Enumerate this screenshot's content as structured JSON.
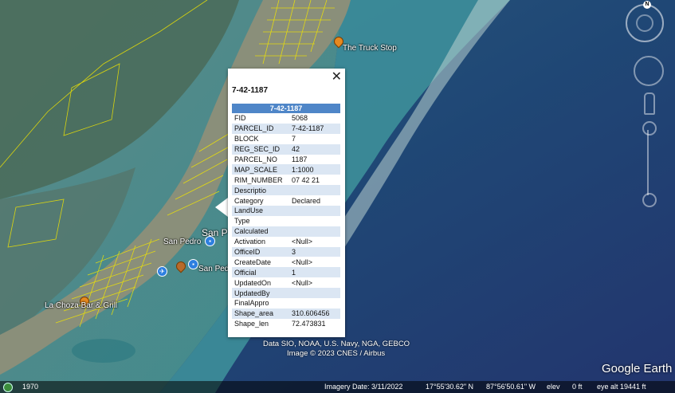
{
  "map": {
    "places": [
      {
        "name": "The Truck Stop"
      },
      {
        "name": "San Pedro"
      },
      {
        "name": "San Pedro Airport"
      },
      {
        "name": "La Choza Bar & Grill"
      },
      {
        "name": "San P"
      }
    ]
  },
  "popup": {
    "title": "7-42-1187",
    "close_symbol": "✕",
    "header": "7-42-1187",
    "rows": [
      {
        "key": "FID",
        "value": "5068"
      },
      {
        "key": "PARCEL_ID",
        "value": "7-42-1187"
      },
      {
        "key": "BLOCK",
        "value": "7"
      },
      {
        "key": "REG_SEC_ID",
        "value": "42"
      },
      {
        "key": "PARCEL_NO",
        "value": "1187"
      },
      {
        "key": "MAP_SCALE",
        "value": "1:1000"
      },
      {
        "key": "RIM_NUMBER",
        "value": "07 42 21"
      },
      {
        "key": "Descriptio",
        "value": ""
      },
      {
        "key": "Category",
        "value": "Declared"
      },
      {
        "key": "LandUse",
        "value": ""
      },
      {
        "key": "Type",
        "value": ""
      },
      {
        "key": "Calculated",
        "value": ""
      },
      {
        "key": "Activation",
        "value": "<Null>"
      },
      {
        "key": "OfficeID",
        "value": "3"
      },
      {
        "key": "CreateDate",
        "value": "<Null>"
      },
      {
        "key": "Official",
        "value": "1"
      },
      {
        "key": "UpdatedOn",
        "value": "<Null>"
      },
      {
        "key": "UpdatedBy",
        "value": ""
      },
      {
        "key": "FinalAppro",
        "value": ""
      },
      {
        "key": "Shape_area",
        "value": "310.606456"
      },
      {
        "key": "Shape_len",
        "value": "72.473831"
      }
    ]
  },
  "controls": {
    "compass_label": "N"
  },
  "attribution": {
    "line1": "Data SIO, NOAA, U.S. Navy, NGA, GEBCO",
    "line2": "Image © 2023 CNES / Airbus"
  },
  "brand": "Google Earth",
  "status": {
    "year": "1970",
    "imagery_date": "Imagery Date: 3/11/2022",
    "lat": "17°55'30.62\" N",
    "lon": "87°56'50.61\" W",
    "elev_label": "elev",
    "elev_value": "0 ft",
    "eye_alt": "eye alt  19441 ft"
  },
  "icons": {
    "close": "close-icon",
    "compass": "compass-icon",
    "pegman": "pegman-icon",
    "globe": "globe-icon"
  },
  "colors": {
    "popup_header": "#4f86c8",
    "row_alt": "#dbe6f3",
    "parcel_lines": "#f2e600",
    "pin": "#e6891f"
  }
}
